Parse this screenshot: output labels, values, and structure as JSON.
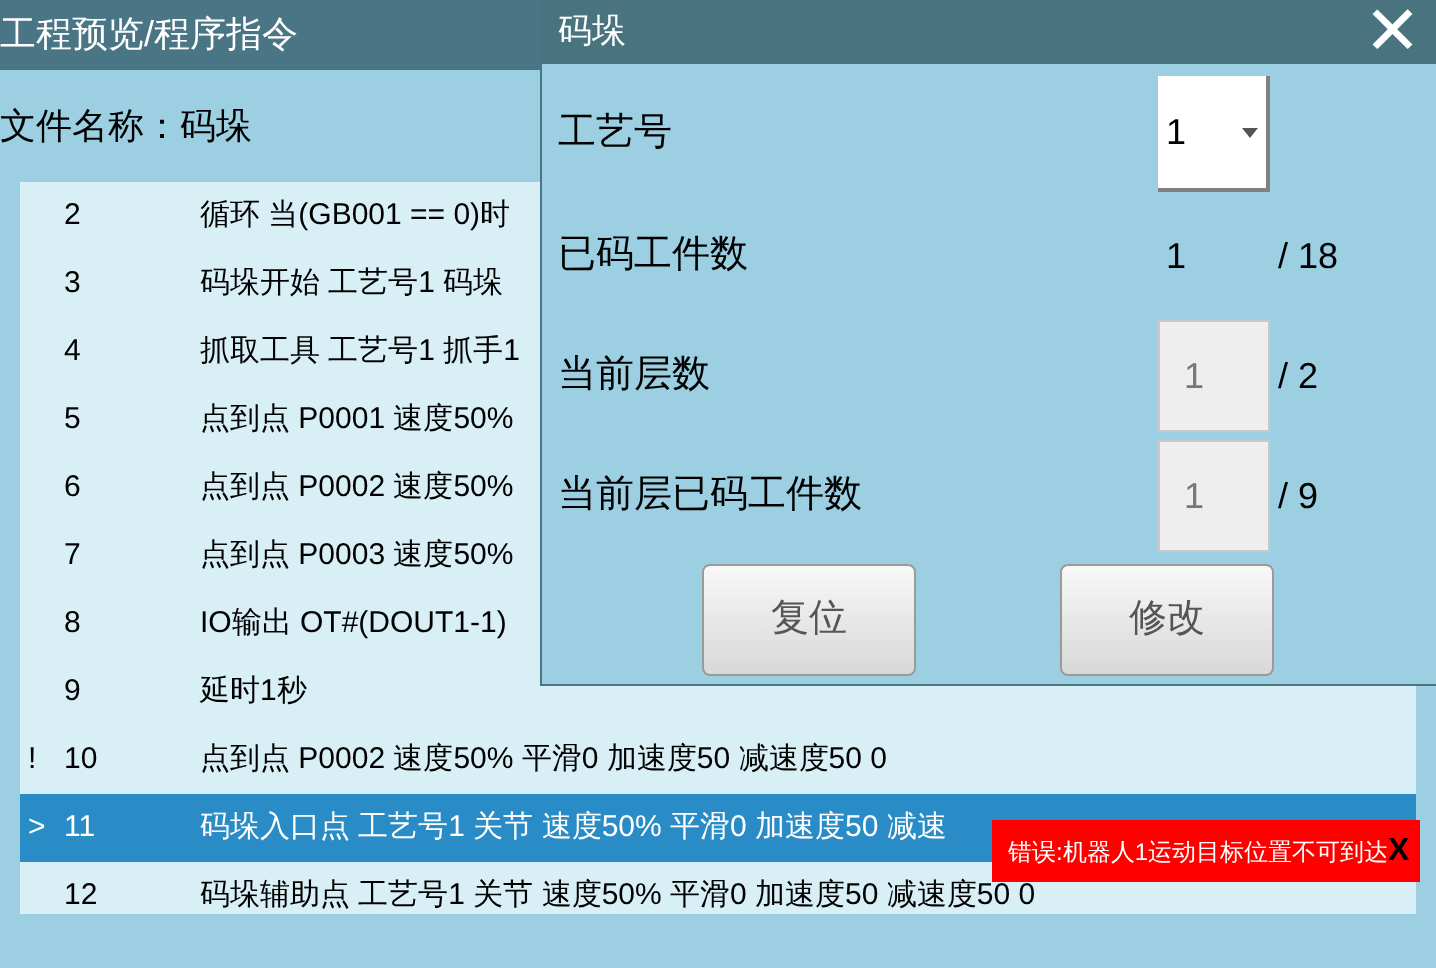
{
  "window": {
    "title": "工程预览/程序指令"
  },
  "file_name": "文件名称：码垛",
  "program": {
    "rows": [
      {
        "marker": "",
        "number": "2",
        "text": "循环 当(GB001 == 0)时",
        "selected": false
      },
      {
        "marker": "",
        "number": "3",
        "text": "码垛开始 工艺号1 码垛",
        "selected": false
      },
      {
        "marker": "",
        "number": "4",
        "text": "抓取工具 工艺号1 抓手1",
        "selected": false
      },
      {
        "marker": "",
        "number": "5",
        "text": "点到点 P0001 速度50%",
        "selected": false
      },
      {
        "marker": "",
        "number": "6",
        "text": "点到点 P0002 速度50%",
        "selected": false
      },
      {
        "marker": "",
        "number": "7",
        "text": "点到点 P0003 速度50%",
        "selected": false
      },
      {
        "marker": "",
        "number": "8",
        "text": "IO输出 OT#(DOUT1-1)",
        "selected": false
      },
      {
        "marker": "",
        "number": "9",
        "text": "延时1秒",
        "selected": false
      },
      {
        "marker": "!",
        "number": "10",
        "text": "点到点 P0002 速度50% 平滑0 加速度50 减速度50 0",
        "selected": false
      },
      {
        "marker": ">",
        "number": "11",
        "text": "码垛入口点 工艺号1 关节 速度50% 平滑0 加速度50 减速",
        "selected": true
      },
      {
        "marker": "",
        "number": "12",
        "text": "码垛辅助点 工艺号1 关节 速度50% 平滑0 加速度50 减速度50 0",
        "selected": false
      }
    ]
  },
  "dialog": {
    "title": "码垛",
    "close": "✕",
    "fields": [
      {
        "kind": "select",
        "label": "工艺号",
        "value": "1"
      },
      {
        "kind": "text",
        "label": "已码工件数",
        "value": "1",
        "total": "/ 18"
      },
      {
        "kind": "input",
        "label": "当前层数",
        "value": "1",
        "total": "/ 2",
        "disabled": true
      },
      {
        "kind": "input",
        "label": "当前层已码工件数",
        "value": "1",
        "total": "/ 9",
        "disabled": true
      }
    ],
    "buttons": [
      "复位",
      "修改"
    ]
  },
  "error_toast": {
    "message": "错误:机器人1运动目标位置不可到达",
    "close": "X"
  }
}
